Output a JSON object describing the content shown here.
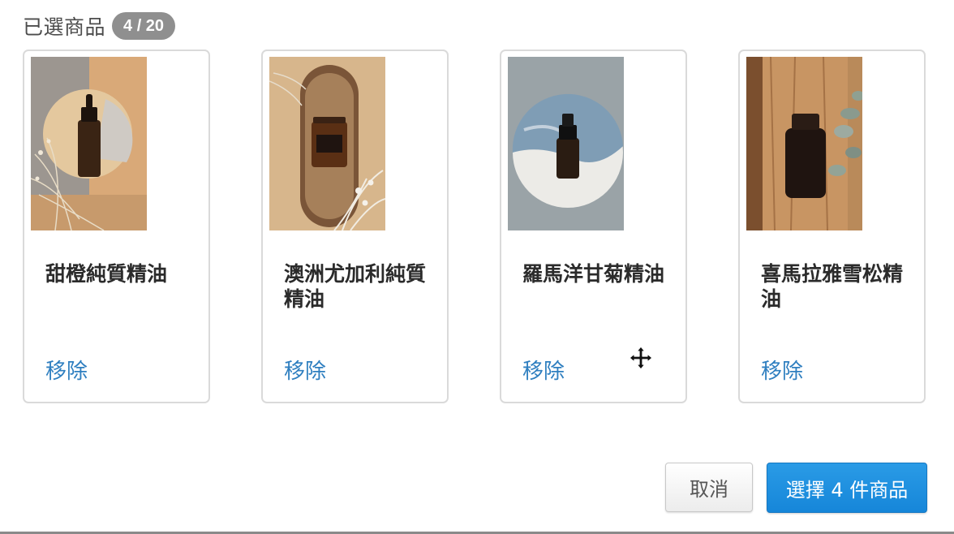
{
  "header": {
    "title": "已選商品",
    "count": "4 / 20"
  },
  "products": [
    {
      "name": "甜橙純質精油",
      "remove_label": "移除",
      "image_icon": "amber-dropper-bottle-photo"
    },
    {
      "name": "澳洲尤加利純質精油",
      "remove_label": "移除",
      "image_icon": "amber-jar-on-wood-tray-photo"
    },
    {
      "name": "羅馬洋甘菊精油",
      "remove_label": "移除",
      "image_icon": "spray-bottle-on-ceramic-plate-photo"
    },
    {
      "name": "喜馬拉雅雪松精油",
      "remove_label": "移除",
      "image_icon": "dark-glass-jar-on-wood-photo"
    }
  ],
  "footer": {
    "cancel_label": "取消",
    "confirm_label": "選擇 4 件商品"
  },
  "colors": {
    "accent": "#2f7fc0",
    "primary_button": "#1a8ad9",
    "badge": "#8f8f8f"
  },
  "cursor_icon": "move-cursor-icon"
}
